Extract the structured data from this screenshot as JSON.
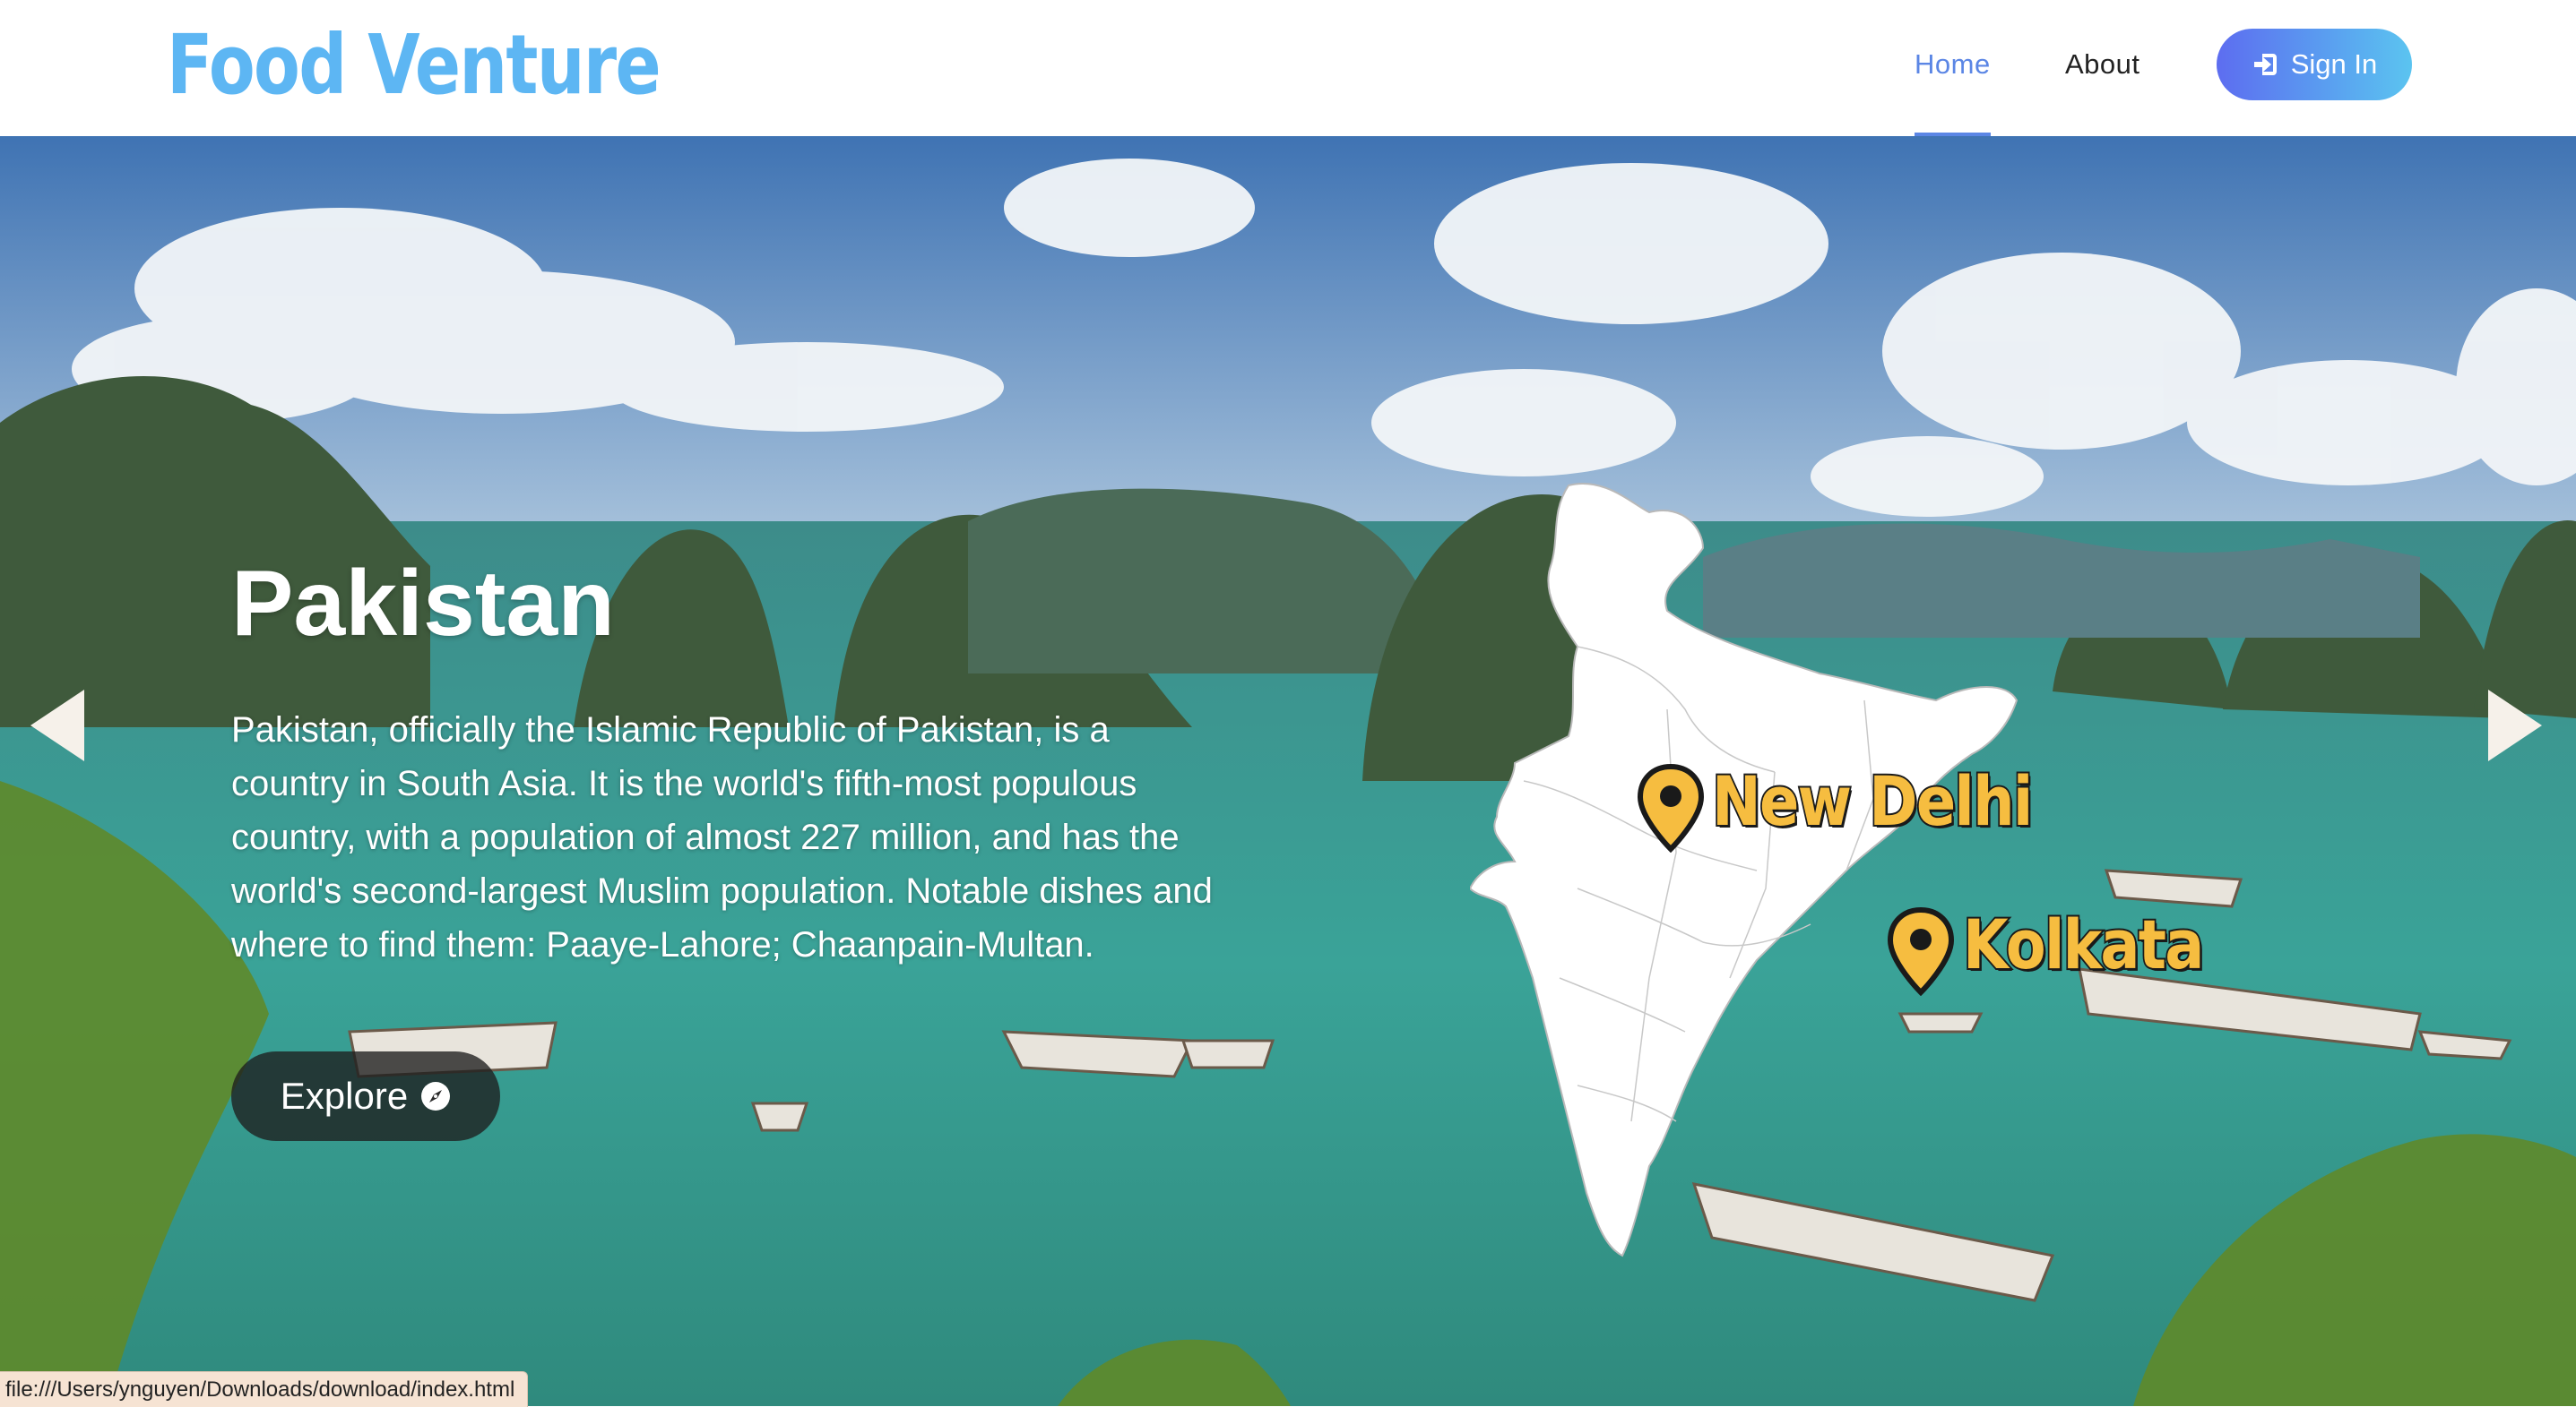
{
  "header": {
    "brand": "Food Venture",
    "nav": {
      "home": "Home",
      "about": "About"
    },
    "signin_label": "Sign In",
    "signin_icon": "sign-in-icon"
  },
  "hero": {
    "title": "Pakistan",
    "description": "Pakistan, officially the Islamic Republic of Pakistan, is a country in South Asia. It is the world's fifth-most populous country, with a population of almost 227 million, and has the world's second-largest Muslim population. Notable dishes and where to find them: Paaye-Lahore; Chaanpain-Multan.",
    "explore_label": "Explore",
    "explore_icon": "compass-icon",
    "map": {
      "cities": [
        "New Delhi",
        "Kolkata"
      ],
      "pin_color": "#f6bd40"
    }
  },
  "status_bar": {
    "url": "file:///Users/ynguyen/Downloads/download/index.html"
  },
  "colors": {
    "brand": "#5db6f3",
    "nav_active": "#5b86e5",
    "button_gradient_start": "#5d6df0",
    "button_gradient_end": "#5bc4f0"
  }
}
